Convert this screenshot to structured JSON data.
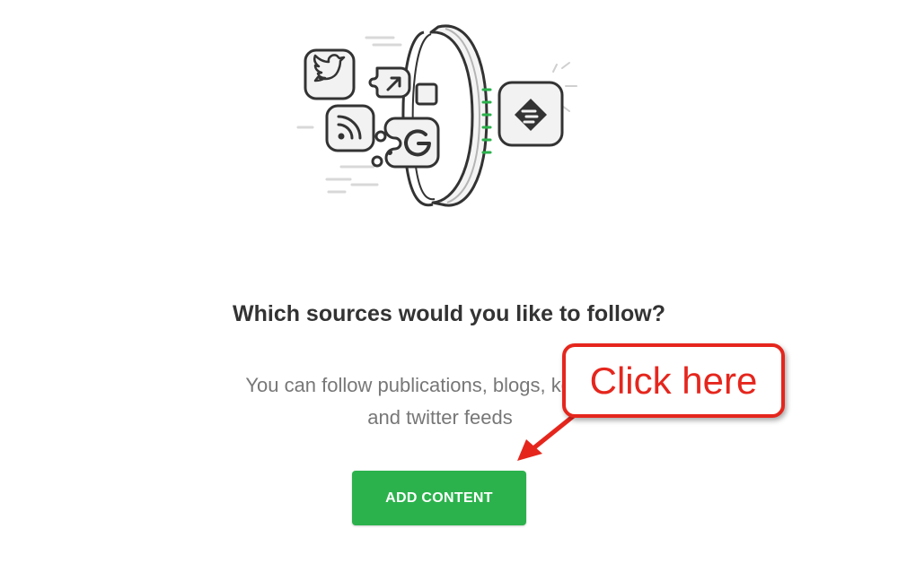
{
  "onboarding": {
    "title": "Which sources would you like to follow?",
    "subtitle_line1": "You can follow publications, blogs, keywords",
    "subtitle_line2": "and twitter feeds",
    "add_button_label": "ADD CONTENT",
    "hero_icons": [
      "twitter-icon",
      "share-icon",
      "rss-icon",
      "google-icon",
      "feedly-icon"
    ]
  },
  "annotation": {
    "callout_text": "Click here"
  },
  "colors": {
    "accent_green": "#2bb24c",
    "annotation_red": "#e5261d",
    "title_text": "#333333",
    "subtitle_text": "#777777"
  }
}
